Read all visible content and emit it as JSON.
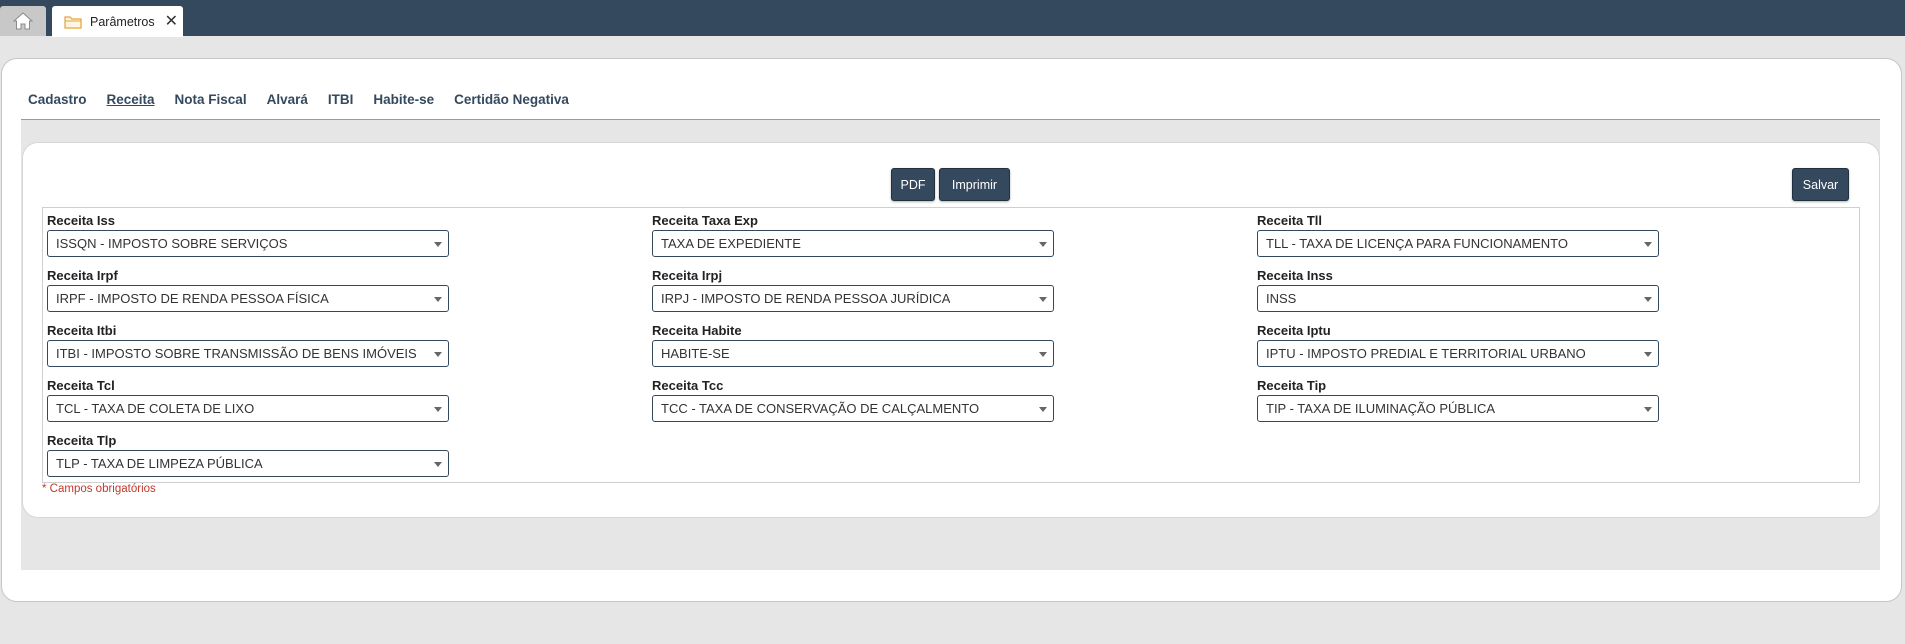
{
  "tabs": {
    "home_icon": "home-icon",
    "active_tab": {
      "label": "Parâmetros",
      "icon": "folder-icon",
      "close": "✕"
    }
  },
  "menu": {
    "items": [
      {
        "label": "Cadastro",
        "active": false
      },
      {
        "label": "Receita",
        "active": true
      },
      {
        "label": "Nota Fiscal",
        "active": false
      },
      {
        "label": "Alvará",
        "active": false
      },
      {
        "label": "ITBI",
        "active": false
      },
      {
        "label": "Habite-se",
        "active": false
      },
      {
        "label": "Certidão Negativa",
        "active": false
      }
    ]
  },
  "toolbar": {
    "pdf_label": "PDF",
    "print_label": "Imprimir",
    "save_label": "Salvar"
  },
  "fields": {
    "iss": {
      "label": "Receita Iss",
      "value": "ISSQN - IMPOSTO SOBRE SERVIÇOS"
    },
    "exp": {
      "label": "Receita Taxa Exp",
      "value": "TAXA DE EXPEDIENTE"
    },
    "tll": {
      "label": "Receita Tll",
      "value": "TLL - TAXA DE LICENÇA PARA FUNCIONAMENTO"
    },
    "irpf": {
      "label": "Receita Irpf",
      "value": "IRPF - IMPOSTO DE RENDA PESSOA FÍSICA"
    },
    "irpj": {
      "label": "Receita Irpj",
      "value": "IRPJ - IMPOSTO DE RENDA PESSOA JURÍDICA"
    },
    "inss": {
      "label": "Receita Inss",
      "value": "INSS"
    },
    "itbi": {
      "label": "Receita Itbi",
      "value": "ITBI - IMPOSTO SOBRE TRANSMISSÃO DE BENS IMÓVEIS"
    },
    "habite": {
      "label": "Receita Habite",
      "value": "HABITE-SE"
    },
    "iptu": {
      "label": "Receita Iptu",
      "value": "IPTU - IMPOSTO PREDIAL E TERRITORIAL URBANO"
    },
    "tcl": {
      "label": "Receita Tcl",
      "value": "TCL - TAXA DE COLETA DE LIXO"
    },
    "tcc": {
      "label": "Receita Tcc",
      "value": "TCC - TAXA DE CONSERVAÇÃO DE CALÇALMENTO"
    },
    "tip": {
      "label": "Receita Tip",
      "value": "TIP - TAXA DE ILUMINAÇÃO PÚBLICA"
    },
    "tlp": {
      "label": "Receita Tlp",
      "value": "TLP - TAXA DE LIMPEZA PÚBLICA"
    }
  },
  "footer": {
    "required_note": "* Campos obrigatórios"
  },
  "colors": {
    "topbar": "#34495e",
    "accent": "#34495e",
    "required": "#c0392b",
    "folder_icon": "#e6a23c"
  }
}
